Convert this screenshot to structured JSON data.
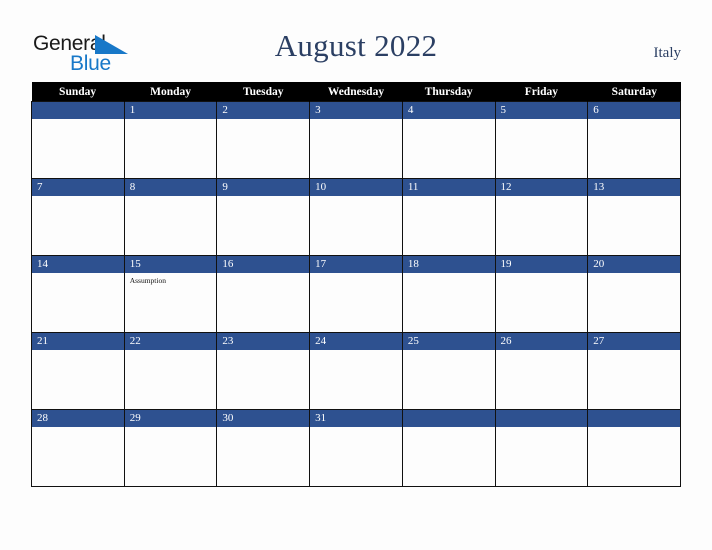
{
  "brand": {
    "line1": "General",
    "line2": "Blue",
    "triangle_color": "#1878c8",
    "line1_color": "#1a1a1a"
  },
  "header": {
    "title": "August 2022",
    "country": "Italy",
    "title_color": "#2b3f63"
  },
  "calendar": {
    "accent_color": "#2e5190",
    "header_bg": "#000000",
    "day_names": [
      "Sunday",
      "Monday",
      "Tuesday",
      "Wednesday",
      "Thursday",
      "Friday",
      "Saturday"
    ],
    "weeks": [
      [
        {
          "date": "",
          "events": []
        },
        {
          "date": "1",
          "events": []
        },
        {
          "date": "2",
          "events": []
        },
        {
          "date": "3",
          "events": []
        },
        {
          "date": "4",
          "events": []
        },
        {
          "date": "5",
          "events": []
        },
        {
          "date": "6",
          "events": []
        }
      ],
      [
        {
          "date": "7",
          "events": []
        },
        {
          "date": "8",
          "events": []
        },
        {
          "date": "9",
          "events": []
        },
        {
          "date": "10",
          "events": []
        },
        {
          "date": "11",
          "events": []
        },
        {
          "date": "12",
          "events": []
        },
        {
          "date": "13",
          "events": []
        }
      ],
      [
        {
          "date": "14",
          "events": []
        },
        {
          "date": "15",
          "events": [
            "Assumption"
          ]
        },
        {
          "date": "16",
          "events": []
        },
        {
          "date": "17",
          "events": []
        },
        {
          "date": "18",
          "events": []
        },
        {
          "date": "19",
          "events": []
        },
        {
          "date": "20",
          "events": []
        }
      ],
      [
        {
          "date": "21",
          "events": []
        },
        {
          "date": "22",
          "events": []
        },
        {
          "date": "23",
          "events": []
        },
        {
          "date": "24",
          "events": []
        },
        {
          "date": "25",
          "events": []
        },
        {
          "date": "26",
          "events": []
        },
        {
          "date": "27",
          "events": []
        }
      ],
      [
        {
          "date": "28",
          "events": []
        },
        {
          "date": "29",
          "events": []
        },
        {
          "date": "30",
          "events": []
        },
        {
          "date": "31",
          "events": []
        },
        {
          "date": "",
          "events": []
        },
        {
          "date": "",
          "events": []
        },
        {
          "date": "",
          "events": []
        }
      ]
    ]
  }
}
